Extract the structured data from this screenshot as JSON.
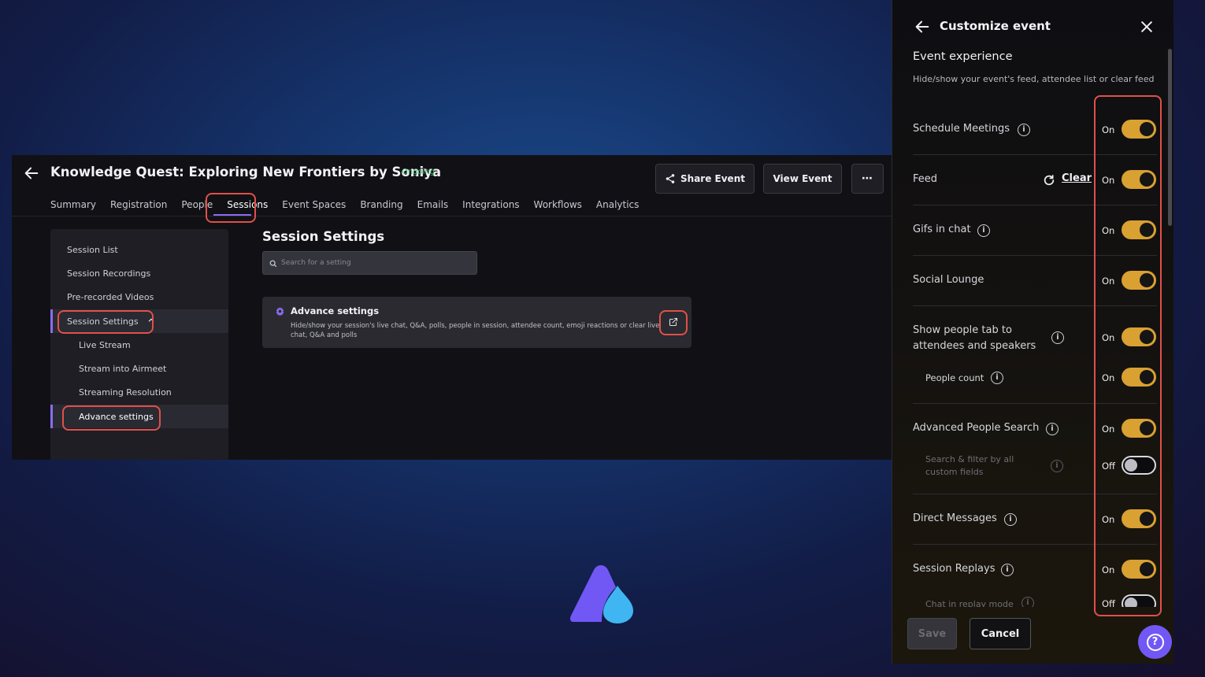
{
  "colors": {
    "accent": "#8a6cf0",
    "toggle_on": "#d9a032",
    "highlight": "#e0504a",
    "status": "#3fb36b"
  },
  "app": {
    "title": "Knowledge Quest: Exploring New Frontiers by Soniya",
    "status": "Ongoing",
    "share_label": "Share Event",
    "view_label": "View Event",
    "more_icon": "more-icon",
    "tabs": [
      "Summary",
      "Registration",
      "People",
      "Sessions",
      "Event Spaces",
      "Branding",
      "Emails",
      "Integrations",
      "Workflows",
      "Analytics"
    ],
    "active_tab": "Sessions"
  },
  "sidebar": {
    "items": [
      "Session List",
      "Session Recordings",
      "Pre-recorded Videos",
      "Session Settings",
      "Live Stream",
      "Stream into Airmeet",
      "Streaming Resolution",
      "Advance settings"
    ]
  },
  "main": {
    "title": "Session Settings",
    "search_placeholder": "Search for a setting",
    "card": {
      "title": "Advance settings",
      "description": "Hide/show your session's live chat, Q&A, polls, people in session, attendee count, emoji reactions or clear live chat, Q&A and polls"
    }
  },
  "panel": {
    "title": "Customize event",
    "section_title": "Event experience",
    "section_desc": "Hide/show your event's feed, attendee list or clear feed",
    "clear_label": "Clear",
    "rows": [
      {
        "label": "Schedule Meetings",
        "state": "On"
      },
      {
        "label": "Feed",
        "state": "On"
      },
      {
        "label": "Gifs in chat",
        "state": "On"
      },
      {
        "label": "Social Lounge",
        "state": "On"
      },
      {
        "label": "Show people tab to attendees and speakers",
        "state": "On"
      },
      {
        "label": "People count",
        "state": "On"
      },
      {
        "label": "Advanced People Search",
        "state": "On"
      },
      {
        "label": "Search & filter by all custom fields",
        "state": "Off"
      },
      {
        "label": "Direct Messages",
        "state": "On"
      },
      {
        "label": "Session Replays",
        "state": "On"
      },
      {
        "label": "Chat in replay mode",
        "state": "Off"
      }
    ],
    "save_label": "Save",
    "cancel_label": "Cancel",
    "help_icon": "question-icon"
  }
}
